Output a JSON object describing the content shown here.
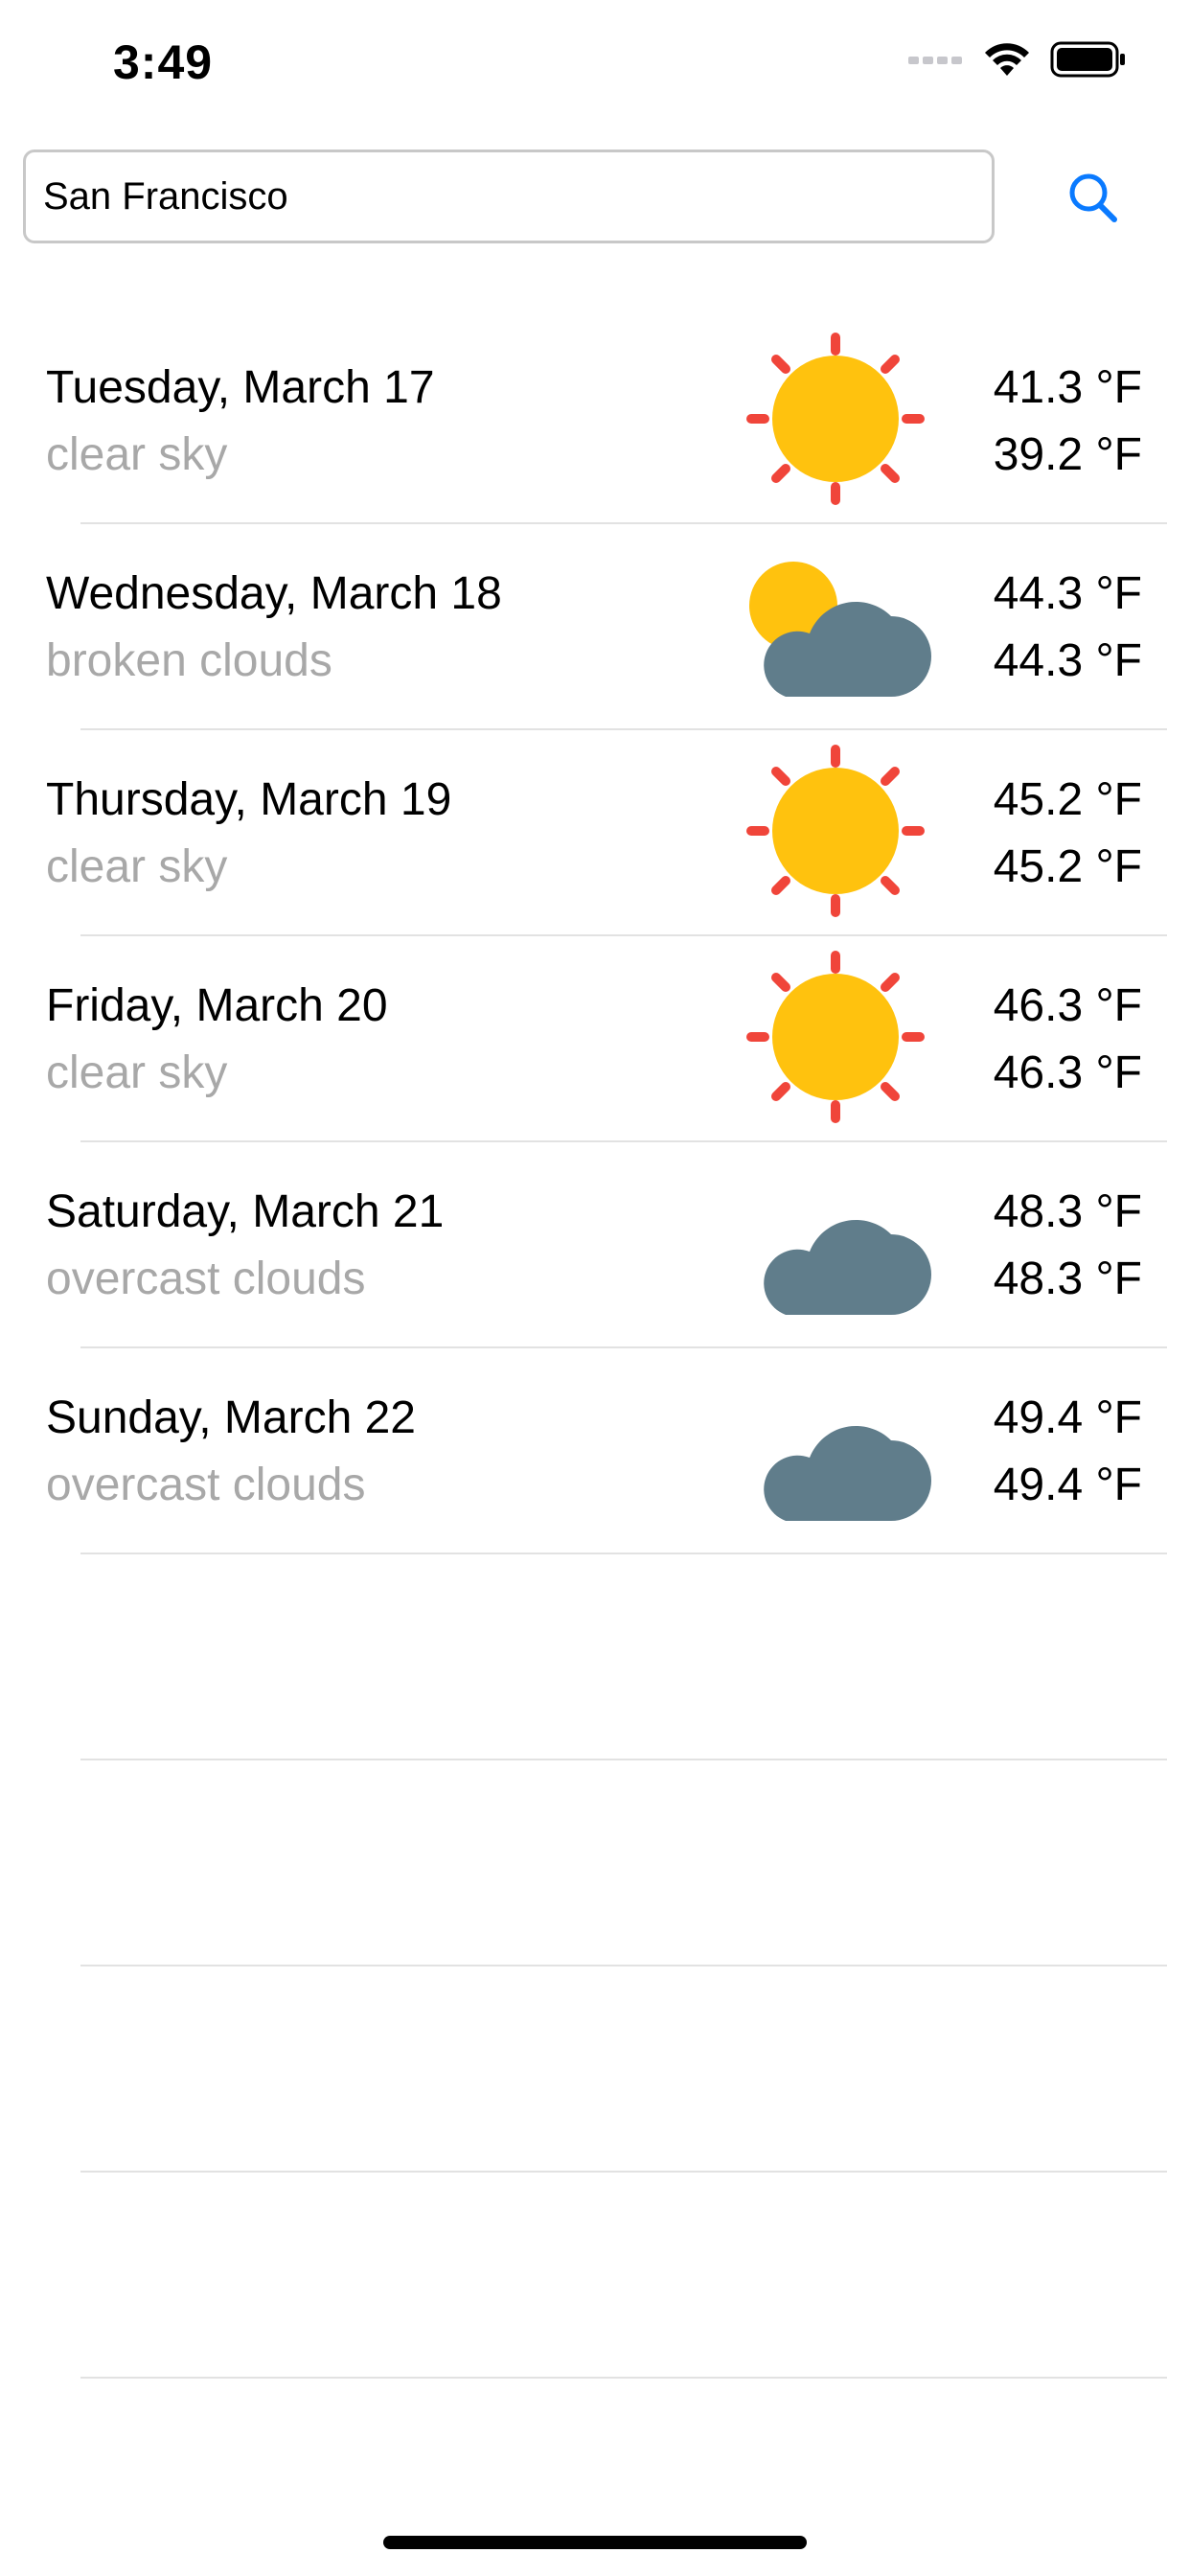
{
  "status_bar": {
    "time": "3:49",
    "icons": [
      "cellular-dots-icon",
      "wifi-icon",
      "battery-icon"
    ]
  },
  "search": {
    "value": "San Francisco",
    "icon": "search-icon",
    "accent_color": "#0a7aff"
  },
  "forecast": [
    {
      "date": "Tuesday, March 17",
      "description": "clear sky",
      "icon": "sun-icon",
      "high": "41.3 °F",
      "low": "39.2 °F"
    },
    {
      "date": "Wednesday, March 18",
      "description": "broken clouds",
      "icon": "sun-behind-cloud-icon",
      "high": "44.3 °F",
      "low": "44.3 °F"
    },
    {
      "date": "Thursday, March 19",
      "description": "clear sky",
      "icon": "sun-icon",
      "high": "45.2 °F",
      "low": "45.2 °F"
    },
    {
      "date": "Friday, March 20",
      "description": "clear sky",
      "icon": "sun-icon",
      "high": "46.3 °F",
      "low": "46.3 °F"
    },
    {
      "date": "Saturday, March 21",
      "description": "overcast clouds",
      "icon": "cloud-icon",
      "high": "48.3 °F",
      "low": "48.3 °F"
    },
    {
      "date": "Sunday, March 22",
      "description": "overcast clouds",
      "icon": "cloud-icon",
      "high": "49.4 °F",
      "low": "49.4 °F"
    }
  ],
  "colors": {
    "sun": "#ffc20e",
    "sun_rays": "#f0453a",
    "cloud": "#607d8b",
    "secondary_text": "#a8a8a8",
    "separator": "#e2e2e2"
  }
}
